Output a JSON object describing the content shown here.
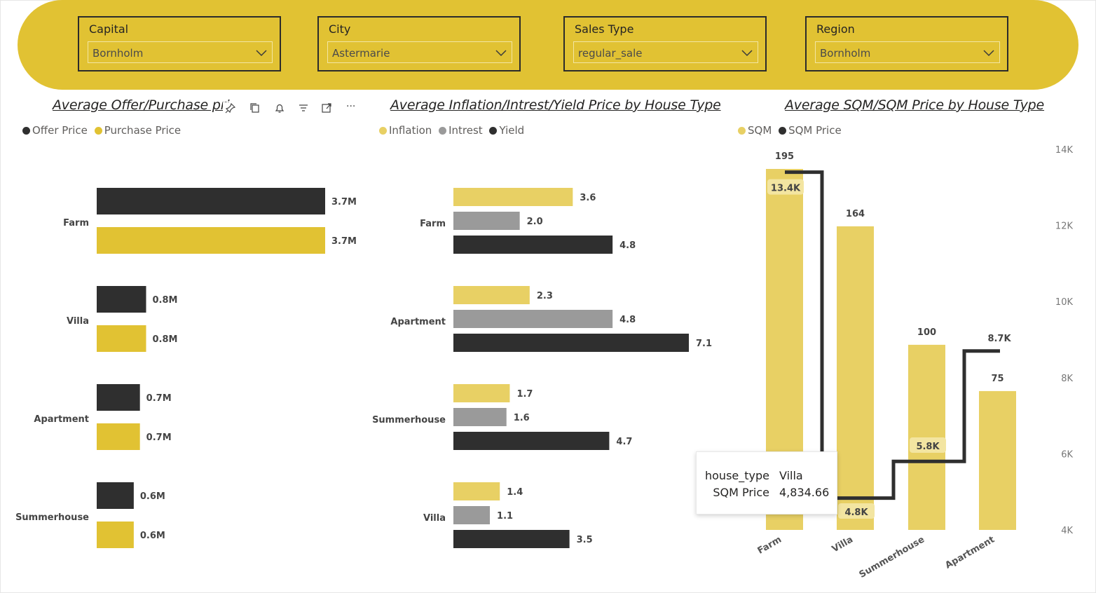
{
  "slicers": [
    {
      "label": "Capital",
      "value": "Bornholm"
    },
    {
      "label": "City",
      "value": "Astermarie"
    },
    {
      "label": "Sales Type",
      "value": "regular_sale"
    },
    {
      "label": "Region",
      "value": "Bornholm"
    }
  ],
  "colors": {
    "yellow": "#e1c233",
    "light_yellow": "#e8d064",
    "dark": "#2f2f2f",
    "grey": "#9a9a9a"
  },
  "visual_toolbar": {
    "icons": [
      "pin-icon",
      "copy-icon",
      "bell-icon",
      "filter-icon",
      "focus-mode-icon",
      "more-options-icon"
    ],
    "more": "···"
  },
  "tooltip": {
    "key1": "house_type",
    "val1": "Villa",
    "key2": "SQM Price",
    "val2": "4,834.66"
  },
  "chart_data": [
    {
      "type": "bar",
      "orientation": "horizontal",
      "title": "Average Offer/Purchase pri",
      "legend": [
        {
          "name": "Offer Price",
          "color": "#2f2f2f"
        },
        {
          "name": "Purchase Price",
          "color": "#e1c233"
        }
      ],
      "categories": [
        "Farm",
        "Villa",
        "Apartment",
        "Summerhouse"
      ],
      "series": [
        {
          "name": "Offer Price",
          "values": [
            3.7,
            0.8,
            0.7,
            0.6
          ],
          "labels": [
            "3.7M",
            "0.8M",
            "0.7M",
            "0.6M"
          ]
        },
        {
          "name": "Purchase Price",
          "values": [
            3.7,
            0.8,
            0.7,
            0.6
          ],
          "labels": [
            "3.7M",
            "0.8M",
            "0.7M",
            "0.6M"
          ]
        }
      ]
    },
    {
      "type": "bar",
      "orientation": "horizontal",
      "title": "Average Inflation/Intrest/Yield Price by House Type",
      "legend": [
        {
          "name": "Inflation",
          "color": "#e8d064"
        },
        {
          "name": "Intrest",
          "color": "#9a9a9a"
        },
        {
          "name": "Yield",
          "color": "#2f2f2f"
        }
      ],
      "categories": [
        "Farm",
        "Apartment",
        "Summerhouse",
        "Villa"
      ],
      "series": [
        {
          "name": "Inflation",
          "values": [
            3.6,
            2.3,
            1.7,
            1.4
          ],
          "labels": [
            "3.6",
            "2.3",
            "1.7",
            "1.4"
          ]
        },
        {
          "name": "Intrest",
          "values": [
            2.0,
            4.8,
            1.6,
            1.1
          ],
          "labels": [
            "2.0",
            "4.8",
            "1.6",
            "1.1"
          ]
        },
        {
          "name": "Yield",
          "values": [
            4.8,
            7.1,
            4.7,
            3.5
          ],
          "labels": [
            "4.8",
            "7.1",
            "4.7",
            "3.5"
          ]
        }
      ]
    },
    {
      "type": "bar",
      "title": "Average SQM/SQM Price by House Type",
      "legend": [
        {
          "name": "SQM",
          "color": "#e8d064"
        },
        {
          "name": "SQM Price",
          "color": "#2f2f2f"
        }
      ],
      "categories": [
        "Farm",
        "Villa",
        "Summerhouse",
        "Apartment"
      ],
      "series": [
        {
          "name": "SQM",
          "type": "bar",
          "values": [
            195,
            164,
            100,
            75
          ],
          "labels": [
            "195",
            "164",
            "100",
            "75"
          ]
        },
        {
          "name": "SQM Price",
          "type": "line",
          "step": true,
          "values": [
            13400,
            4834.66,
            5800,
            8700
          ],
          "labels": [
            "13.4K",
            "4.8K",
            "5.8K",
            "8.7K"
          ]
        }
      ],
      "y2_ticks": [
        "14K",
        "12K",
        "10K",
        "8K",
        "6K",
        "4K"
      ],
      "y2_lim": [
        4000,
        14000
      ]
    }
  ]
}
